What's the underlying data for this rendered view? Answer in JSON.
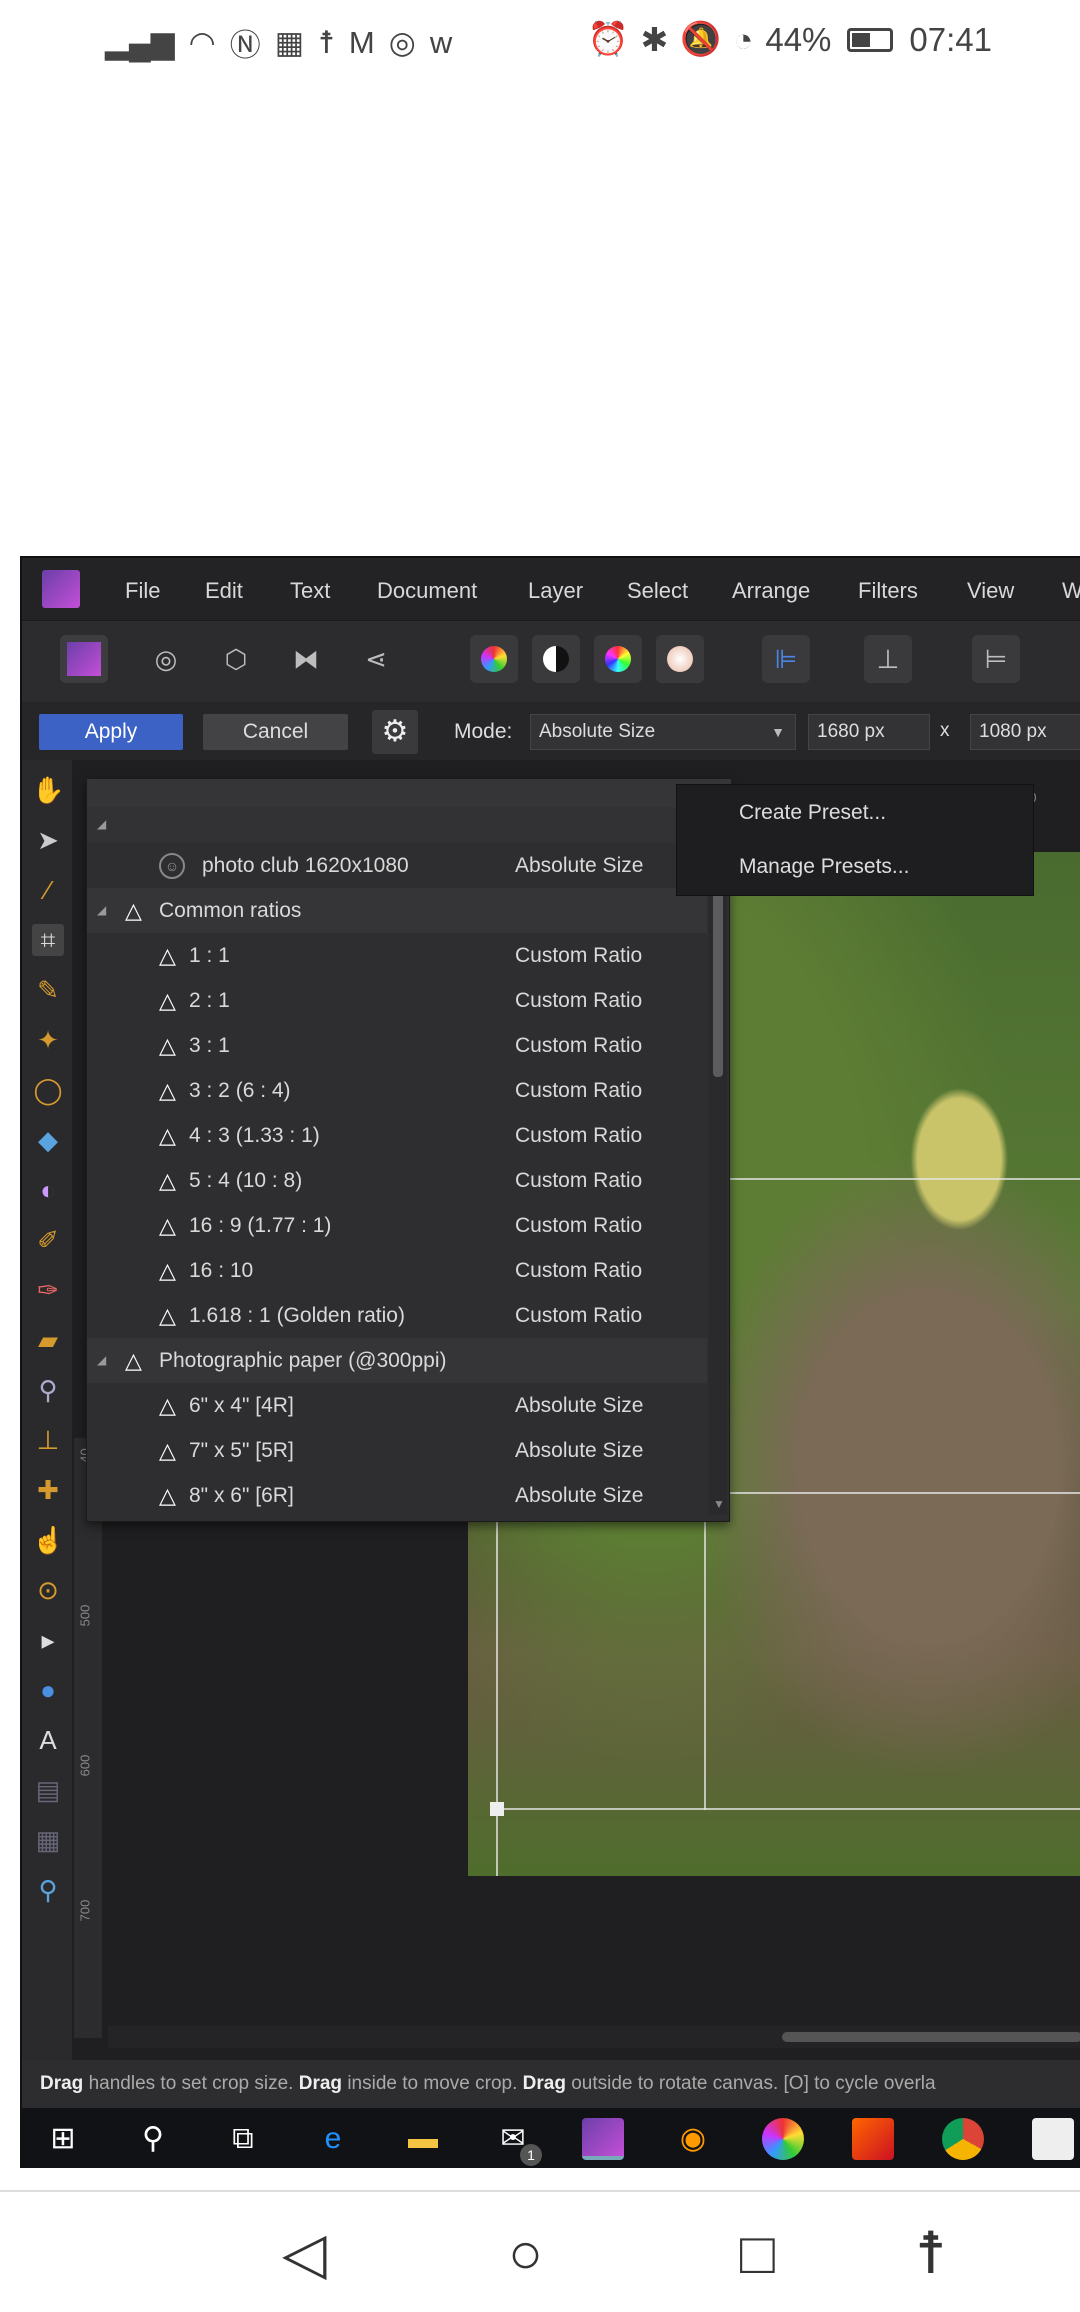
{
  "status_bar": {
    "left_icons": [
      "signal-icon",
      "wifi-icon",
      "nfc-icon",
      "flipboard-icon",
      "accessibility-icon",
      "gmail-icon",
      "instagram-icon",
      "w-app-icon"
    ],
    "battery": "44%",
    "time": "07:41"
  },
  "app": {
    "menu": [
      "File",
      "Edit",
      "Text",
      "Document",
      "Layer",
      "Select",
      "Arrange",
      "Filters",
      "View",
      "W"
    ],
    "context": {
      "apply": "Apply",
      "cancel": "Cancel",
      "mode_label": "Mode:",
      "mode_value": "Absolute Size",
      "width": "1680 px",
      "x": "x",
      "height": "1080 px"
    },
    "presets": {
      "user_preset": {
        "name": "photo club 1620x1080",
        "type": "Absolute Size"
      },
      "groups": [
        {
          "name": "Common ratios",
          "items": [
            {
              "name": "1 : 1",
              "type": "Custom Ratio"
            },
            {
              "name": "2 : 1",
              "type": "Custom Ratio"
            },
            {
              "name": "3 : 1",
              "type": "Custom Ratio"
            },
            {
              "name": "3 : 2  (6 : 4)",
              "type": "Custom Ratio"
            },
            {
              "name": "4 : 3  (1.33 : 1)",
              "type": "Custom Ratio"
            },
            {
              "name": "5 : 4  (10 : 8)",
              "type": "Custom Ratio"
            },
            {
              "name": "16 : 9  (1.77 : 1)",
              "type": "Custom Ratio"
            },
            {
              "name": "16 : 10",
              "type": "Custom Ratio"
            },
            {
              "name": "1.618 : 1  (Golden ratio)",
              "type": "Custom Ratio"
            }
          ]
        },
        {
          "name": "Photographic paper (@300ppi)",
          "items": [
            {
              "name": "6\" x 4\"  [4R]",
              "type": "Absolute Size"
            },
            {
              "name": "7\" x 5\"  [5R]",
              "type": "Absolute Size"
            },
            {
              "name": "8\" x 6\"  [6R]",
              "type": "Absolute Size"
            }
          ]
        }
      ]
    },
    "context_menu": [
      "Create Preset...",
      "Manage Presets..."
    ],
    "ruler_labels": [
      "40",
      "500",
      "600",
      "700"
    ],
    "ruler_top": "40",
    "hint": {
      "b1": "Drag",
      "t1": " handles to set crop size. ",
      "b2": "Drag",
      "t2": " inside to move crop. ",
      "b3": "Drag",
      "t3": " outside to rotate canvas. [O] to cycle overla"
    },
    "taskbar_badge": "1"
  }
}
